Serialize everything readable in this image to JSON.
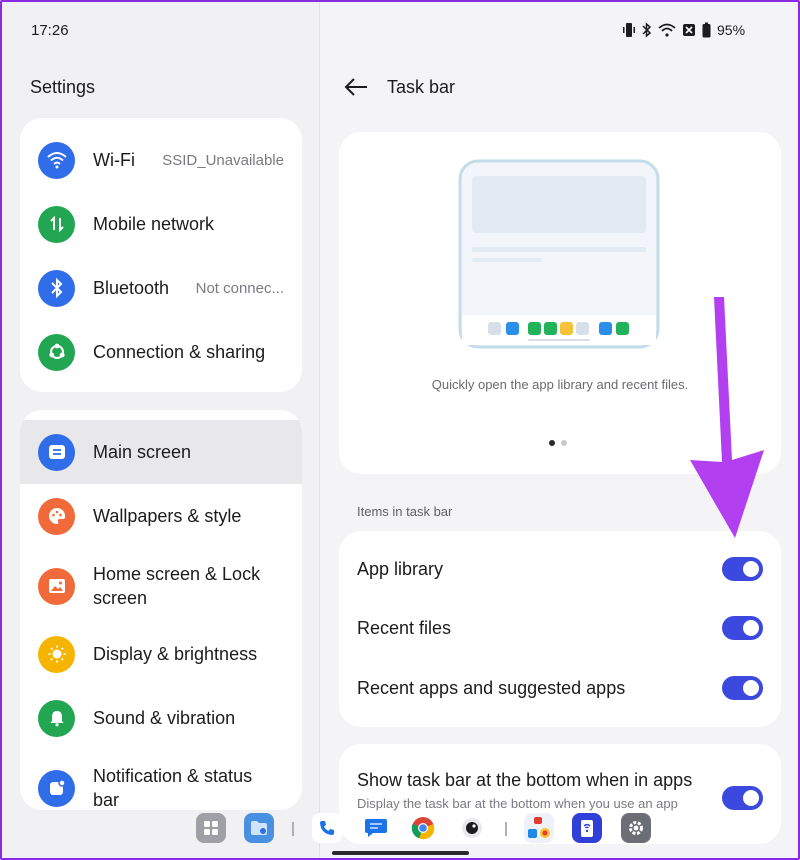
{
  "status_bar": {
    "time": "17:26",
    "battery": "95%"
  },
  "left": {
    "title": "Settings",
    "group1": [
      {
        "label": "Wi-Fi",
        "value": "SSID_Unavailable",
        "icon": "wifi-icon",
        "color": "#2f6ee8"
      },
      {
        "label": "Mobile network",
        "value": "",
        "icon": "mobile-data-icon",
        "color": "#22a652"
      },
      {
        "label": "Bluetooth",
        "value": "Not connec...",
        "icon": "bluetooth-icon",
        "color": "#2f6ee8"
      },
      {
        "label": "Connection & sharing",
        "value": "",
        "icon": "share-icon",
        "color": "#22a652"
      }
    ],
    "group2": [
      {
        "label": "Main screen",
        "icon": "main-screen-icon",
        "color": "#2f6ee8",
        "selected": true
      },
      {
        "label": "Wallpapers & style",
        "icon": "palette-icon",
        "color": "#f06a3a"
      },
      {
        "label": "Home screen & Lock screen",
        "line1": "Home screen & Lock",
        "line2": "screen",
        "icon": "image-icon",
        "color": "#f06a3a"
      },
      {
        "label": "Display & brightness",
        "icon": "sun-icon",
        "color": "#f5b400"
      },
      {
        "label": "Sound & vibration",
        "icon": "bell-icon",
        "color": "#22a652"
      },
      {
        "label": "Notification & status bar",
        "line1": "Notification & status",
        "line2": "bar",
        "icon": "notification-icon",
        "color": "#2f6ee8"
      }
    ]
  },
  "right": {
    "title": "Task bar",
    "preview_caption": "Quickly open the app library and recent files.",
    "section_label": "Items in task bar",
    "items": [
      {
        "label": "App library",
        "on": true
      },
      {
        "label": "Recent files",
        "on": true
      },
      {
        "label": "Recent apps and suggested apps",
        "on": true
      }
    ],
    "bottom": {
      "title": "Show task bar at the bottom when in apps",
      "subtitle": "Display the task bar at the bottom when you use an app",
      "on": true
    }
  },
  "colors": {
    "accent": "#3b49df",
    "annotation_arrow": "#b23ff0"
  },
  "dock": [
    "app-drawer-icon",
    "files-icon",
    "phone-icon",
    "messages-icon",
    "chrome-icon",
    "camera-icon",
    "recent-apps-icon",
    "remote-icon",
    "settings-icon"
  ]
}
